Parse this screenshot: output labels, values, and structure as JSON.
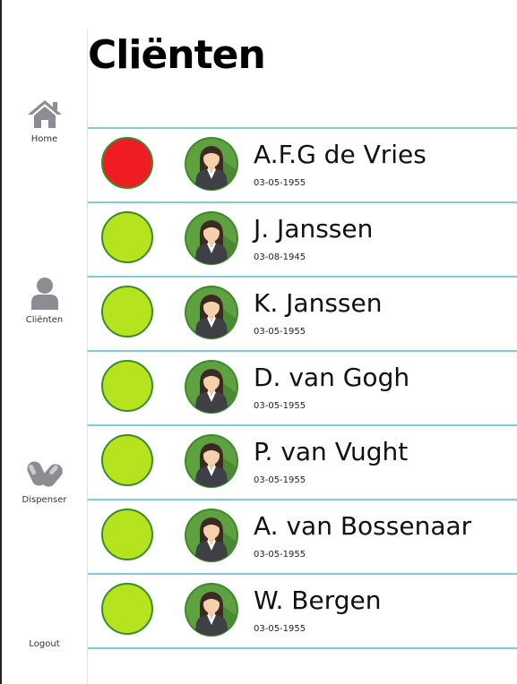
{
  "page": {
    "title": "Cliënten"
  },
  "sidebar": {
    "items": [
      {
        "label": "Home",
        "icon": "home-icon"
      },
      {
        "label": "Cliënten",
        "icon": "user-icon"
      },
      {
        "label": "Dispenser",
        "icon": "pill-icon"
      },
      {
        "label": "Logout",
        "icon": ""
      }
    ]
  },
  "status_colors": {
    "alert": "#ef1c24",
    "ok": "#b5e31e",
    "list_divider": "#7ecbe0",
    "avatar_bg": "#5fa041"
  },
  "clients": [
    {
      "name": "A.F.G de Vries",
      "dob": "03-05-1955",
      "status": "alert"
    },
    {
      "name": "J. Janssen",
      "dob": "03-08-1945",
      "status": "ok"
    },
    {
      "name": "K. Janssen",
      "dob": "03-05-1955",
      "status": "ok"
    },
    {
      "name": "D. van Gogh",
      "dob": "03-05-1955",
      "status": "ok"
    },
    {
      "name": "P. van Vught",
      "dob": "03-05-1955",
      "status": "ok"
    },
    {
      "name": "A. van Bossenaar",
      "dob": "03-05-1955",
      "status": "ok"
    },
    {
      "name": "W. Bergen",
      "dob": "03-05-1955",
      "status": "ok"
    }
  ]
}
